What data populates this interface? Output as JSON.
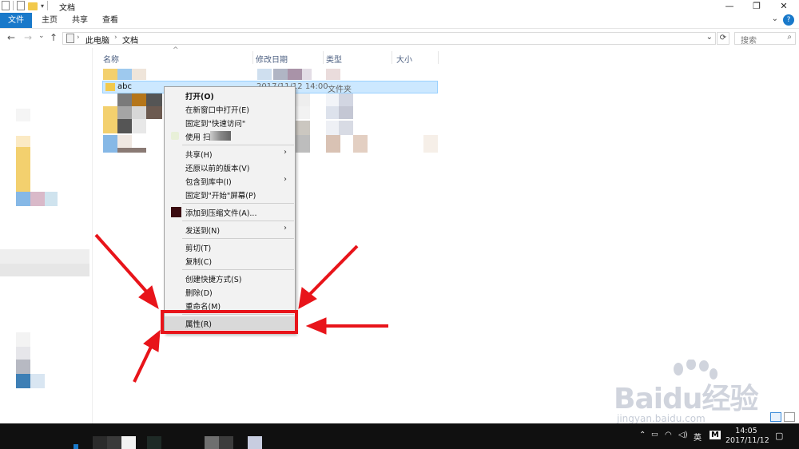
{
  "window": {
    "title": "文档",
    "minimize": "—",
    "maximize": "❐",
    "close": "✕"
  },
  "ribbon": {
    "tabs": [
      "文件",
      "主页",
      "共享",
      "查看"
    ],
    "help": "?"
  },
  "nav": {
    "back": "←",
    "forward": "→",
    "recent": "⌄",
    "up": "↑",
    "breadcrumb": [
      "此电脑",
      "文档"
    ],
    "search_placeholder": "搜索"
  },
  "columns": {
    "name": "名称",
    "date": "修改日期",
    "type": "类型",
    "size": "大小"
  },
  "selected_row": {
    "name": "abc",
    "date": "2017/11/12 14:00",
    "type": "文件夹"
  },
  "context_menu": {
    "items": [
      {
        "label": "打开(O)",
        "bold": true
      },
      {
        "label": "在新窗口中打开(E)"
      },
      {
        "label": "固定到\"快速访问\""
      },
      {
        "label": "使用 扫描"
      },
      {
        "label": "共享(H)",
        "submenu": true
      },
      {
        "label": "还原以前的版本(V)"
      },
      {
        "label": "包含到库中(I)",
        "submenu": true
      },
      {
        "label": "固定到\"开始\"屏幕(P)"
      },
      {
        "label": "添加到压缩文件(A)..."
      },
      {
        "label": "发送到(N)",
        "submenu": true
      },
      {
        "label": "剪切(T)"
      },
      {
        "label": "复制(C)"
      },
      {
        "label": "创建快捷方式(S)"
      },
      {
        "label": "删除(D)"
      },
      {
        "label": "重命名(M)"
      },
      {
        "label": "属性(R)",
        "highlighted": true
      }
    ]
  },
  "taskbar": {
    "ime": "英",
    "ime_mode": "M",
    "time": "14:05",
    "date": "2017/11/12"
  },
  "watermark": {
    "brand": "Baidu经验",
    "url": "jingyan.baidu.com"
  },
  "colors": {
    "accent": "#1979ca",
    "selection": "#cce8ff",
    "annotation_red": "#e8141a"
  }
}
